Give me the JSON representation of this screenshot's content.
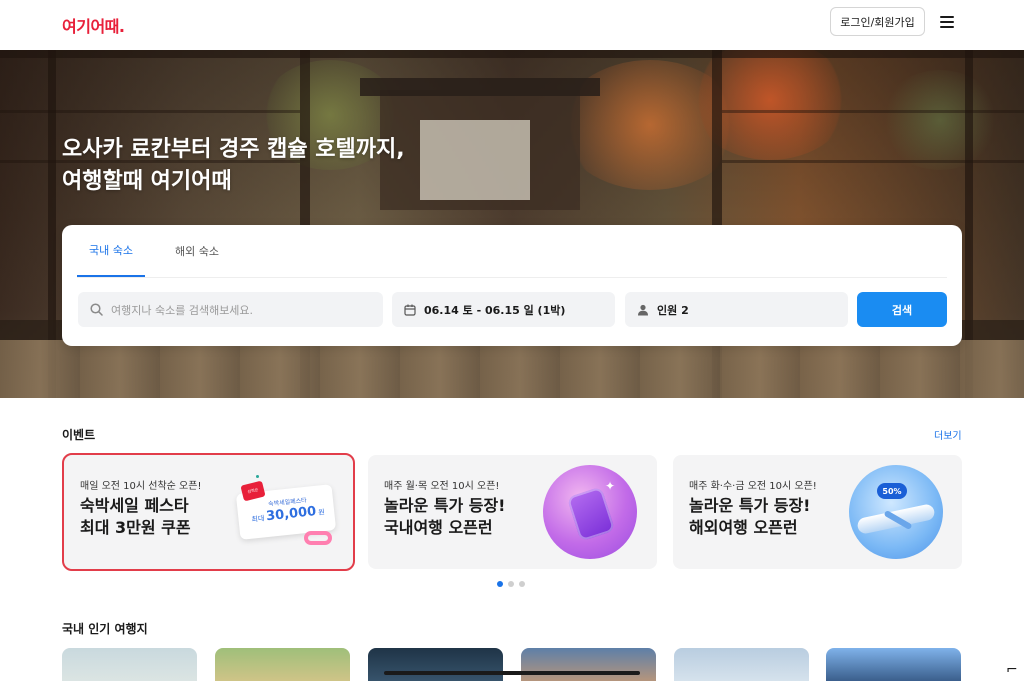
{
  "header": {
    "logo": "여기어때.",
    "login_label": "로그인/회원가입"
  },
  "hero": {
    "title_line1": "오사카 료칸부터 경주 캡슐 호텔까지,",
    "title_line2": "여행할때 여기어때"
  },
  "search": {
    "tabs": [
      {
        "label": "국내 숙소",
        "active": true
      },
      {
        "label": "해외 숙소",
        "active": false
      }
    ],
    "placeholder": "여행지나 숙소를 검색해보세요.",
    "date_value": "06.14 토 - 06.15 일 (1박)",
    "guest_value": "인원 2",
    "button_label": "검색"
  },
  "events": {
    "title": "이벤트",
    "more_label": "더보기",
    "cards": [
      {
        "subtitle": "매일 오전 10시 선착순 오픈!",
        "title_line1": "숙박세일 페스타",
        "title_line2": "최대 3만원 쿠폰",
        "coupon_small": "숙박세일페스타",
        "coupon_prefix": "최대",
        "coupon_amount": "30,000",
        "coupon_unit": "원",
        "ticket_tag": "선착순"
      },
      {
        "subtitle": "매주 월·목 오전 10시 오픈!",
        "title_line1": "놀라운 특가 등장!",
        "title_line2": "국내여행 오픈런"
      },
      {
        "subtitle": "매주 화·수·금 오전 10시 오픈!",
        "title_line1": "놀라운 특가 등장!",
        "title_line2": "해외여행 오픈런",
        "badge": "50%"
      }
    ],
    "carousel_active": 1,
    "carousel_count": 3
  },
  "destinations": {
    "title": "국내 인기 여행지"
  },
  "colors": {
    "brand": "#e8203a",
    "accent": "#1a8cf2",
    "link": "#1a73e8",
    "highlight_outline": "#e23d4a"
  }
}
